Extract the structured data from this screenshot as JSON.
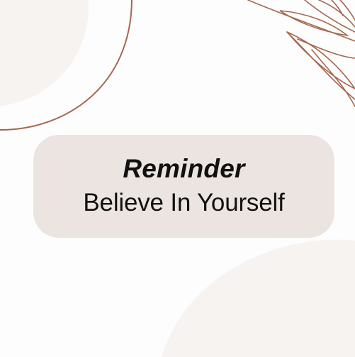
{
  "colors": {
    "background": "#fefdfd",
    "blob": "#f6f3f0",
    "line_accent": "#a4674e",
    "card": "#ebe4e1",
    "text": "#111111"
  },
  "card": {
    "title": "Reminder",
    "message": "Believe In Yourself"
  }
}
